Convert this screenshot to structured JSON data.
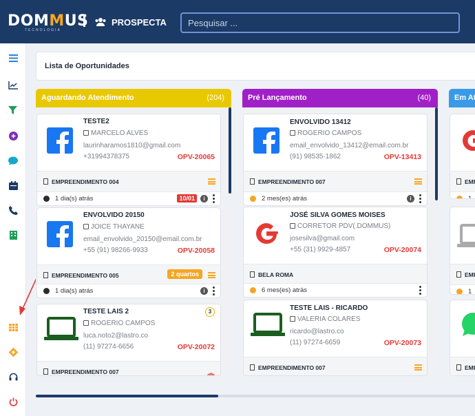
{
  "app": {
    "logo_a": "DOM",
    "logo_b": "M",
    "logo_c": "US",
    "logo_sub": "TECNOLOGIA",
    "module": "PROSPECTA",
    "search_placeholder": "Pesquisar ..."
  },
  "page": {
    "title": "Lista de Oportunidades"
  },
  "sidebar": {
    "icons": [
      "menu-icon",
      "chart-line-icon",
      "funnel-icon",
      "add-circle-icon",
      "chat-icon",
      "calendar-icon",
      "phone-icon",
      "building-icon",
      "grid-icon",
      "gear-icon",
      "headset-icon",
      "power-icon"
    ]
  },
  "columns": [
    {
      "title": "Aguardando Atendimento",
      "count": "(204)",
      "color": "#e8c800",
      "cards": [
        {
          "name": "TESTE2",
          "agent": "MARCELO ALVES",
          "email": "laurinharamos1810@gmail.com",
          "phone": "+31994378375",
          "opv": "OPV-20065",
          "empreendimento": "EMPREENDIMENTO 004",
          "time": "1 dia(s) atrás",
          "date": "10/01",
          "source": "facebook"
        },
        {
          "name": "ENVOLVIDO 20150",
          "agent": "JOICE THAYANE",
          "email": "email_envolvido_20150@email.com.br",
          "phone": "+55 (91) 98266-9933",
          "opv": "OPV-20058",
          "empreendimento": "EMPREENDIMENTO 005",
          "tag": "2 quartos",
          "time": "1 dia(s) atrás",
          "source": "facebook"
        },
        {
          "name": "TESTE LAIS 2",
          "agent": "ROGERIO CAMPOS",
          "email": "luca.noto2@lastro.co",
          "phone": "(11) 97274-6656",
          "opv": "OPV-20072",
          "empreendimento": "EMPREENDIMENTO 007",
          "badge": "3",
          "source": "laptop"
        }
      ]
    },
    {
      "title": "Pré Lançamento",
      "count": "(40)",
      "color": "#a020c8",
      "cards": [
        {
          "name": "ENVOLVIDO 13412",
          "agent": "ROGERIO CAMPOS",
          "email": "email_envolvido_13412@email.com.br",
          "phone": "(91) 98535-1862",
          "opv": "OPV-13413",
          "empreendimento": "EMPREENDIMENTO 007",
          "time": "2 mes(es) atrás",
          "source": "facebook"
        },
        {
          "name": "JOSÉ SILVA GOMES MOISES",
          "agent": "CORRETOR PDV(.DOMMUS)",
          "email": "josesilva@gmail.com",
          "phone": "+55 (31) 9929-4857",
          "opv": "OPV-20074",
          "empreendimento": "BELA ROMA",
          "time": "6 mes(es) atrás",
          "source": "google"
        },
        {
          "name": "TESTE LAIS - RICARDO",
          "agent": "VALERIA COLARES",
          "email": "ricardo@lastro.co",
          "phone": "(11) 97274-6659",
          "opv": "OPV-20073",
          "empreendimento": "EMPREENDIMENTO 007",
          "source": "laptop"
        }
      ]
    },
    {
      "title": "Em At",
      "color": "#3a9ae8",
      "cards": [
        {
          "emp": "EMP",
          "time": "1",
          "source": "google"
        },
        {
          "emp": "EMP",
          "time": "1",
          "source": "laptop-gray"
        },
        {
          "emp": "EMP",
          "source": "whatsapp"
        }
      ]
    }
  ]
}
